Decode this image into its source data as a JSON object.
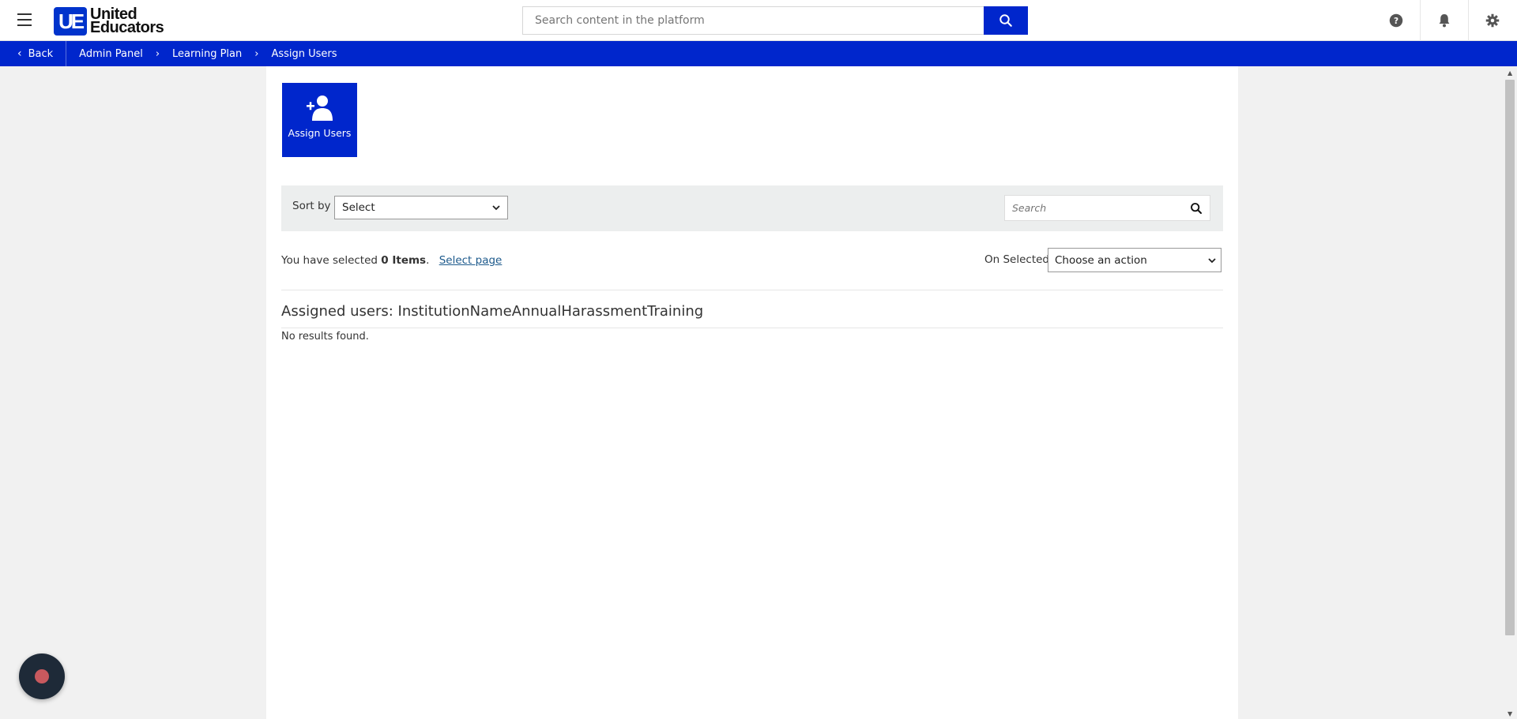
{
  "header": {
    "logo_text_line1": "United",
    "logo_text_line2": "Educators",
    "logo_mark": "UE",
    "search_placeholder": "Search content in the platform",
    "icons": [
      "menu-icon",
      "search-icon",
      "help-icon",
      "bell-icon",
      "gear-icon"
    ]
  },
  "breadcrumb": {
    "back_label": "Back",
    "items": [
      "Admin Panel",
      "Learning Plan",
      "Assign Users"
    ]
  },
  "actions": {
    "assign_users_label": "Assign Users"
  },
  "filters": {
    "sort_label": "Sort by",
    "sort_value": "Select",
    "search_placeholder": "Search"
  },
  "selection": {
    "prefix": "You have selected",
    "count": "0 Items",
    "suffix": ".",
    "select_page_label": "Select page",
    "on_selected_label": "On Selected",
    "action_value": "Choose an action"
  },
  "content": {
    "title": "Assigned users: InstitutionNameAnnualHarassmentTraining",
    "empty_message": "No results found."
  },
  "colors": {
    "brand_blue": "#0026cc",
    "link": "#1d5a8c",
    "float_button": "#1e2a38",
    "float_dot": "#c8595e"
  }
}
